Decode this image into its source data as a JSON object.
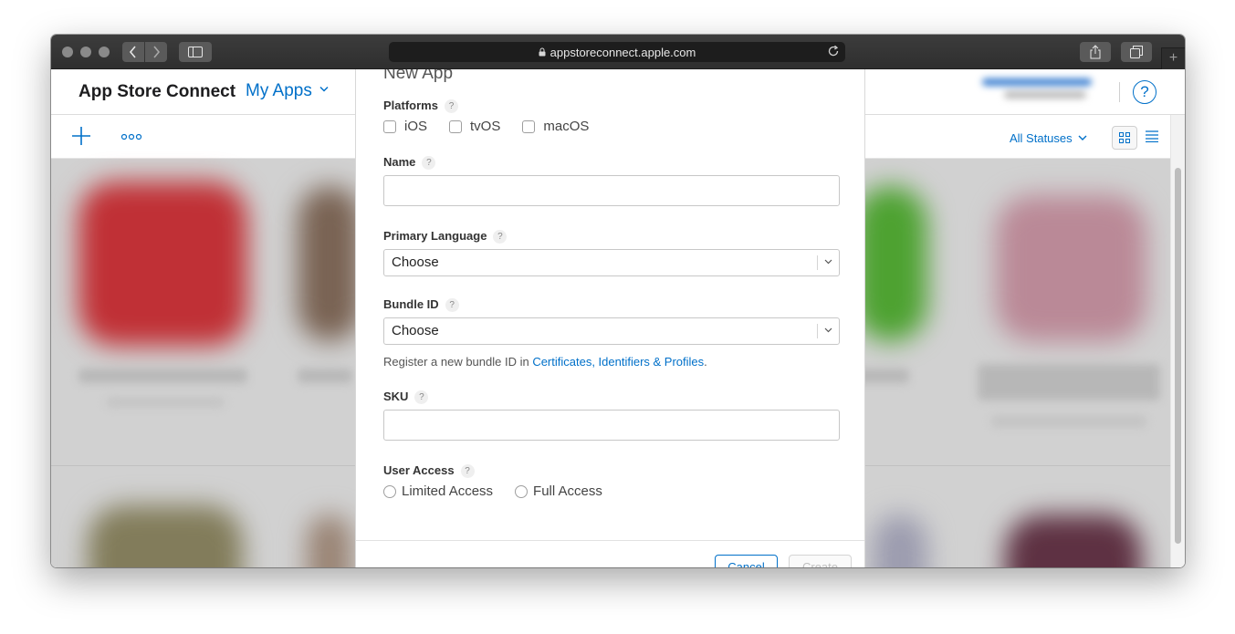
{
  "browser": {
    "url": "appstoreconnect.apple.com"
  },
  "header": {
    "brand": "App Store Connect",
    "section": "My Apps"
  },
  "toolbar": {
    "filter_label": "All Statuses"
  },
  "modal": {
    "title": "New App",
    "platforms": {
      "label": "Platforms",
      "options": [
        "iOS",
        "tvOS",
        "macOS"
      ]
    },
    "name": {
      "label": "Name",
      "value": ""
    },
    "primary_language": {
      "label": "Primary Language",
      "value": "Choose"
    },
    "bundle_id": {
      "label": "Bundle ID",
      "value": "Choose",
      "helper_prefix": "Register a new bundle ID in ",
      "helper_link": "Certificates, Identifiers & Profiles",
      "helper_suffix": "."
    },
    "sku": {
      "label": "SKU",
      "value": ""
    },
    "user_access": {
      "label": "User Access",
      "options": [
        "Limited Access",
        "Full Access"
      ]
    },
    "buttons": {
      "cancel": "Cancel",
      "create": "Create"
    },
    "help_glyph": "?"
  },
  "help_glyph": "?"
}
